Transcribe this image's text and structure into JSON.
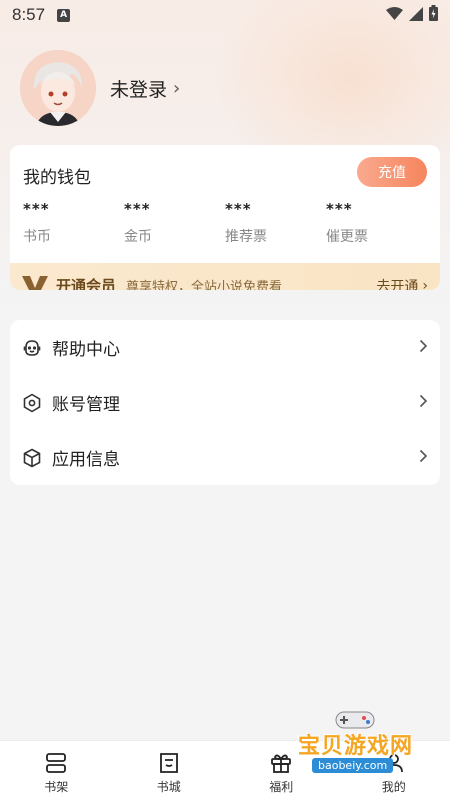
{
  "status_bar": {
    "time": "8:57",
    "indicator": "A"
  },
  "profile": {
    "login_text": "未登录",
    "chevron": "›"
  },
  "wallet": {
    "title": "我的钱包",
    "recharge_label": "充值",
    "stats": [
      {
        "value": "***",
        "label": "书币"
      },
      {
        "value": "***",
        "label": "金币"
      },
      {
        "value": "***",
        "label": "推荐票"
      },
      {
        "value": "***",
        "label": "催更票"
      }
    ],
    "vip": {
      "title": "开通会员",
      "desc": "尊享特权，全站小说免费看",
      "action": "去开通",
      "chevron": "›"
    }
  },
  "menu": [
    {
      "label": "帮助中心",
      "icon": "help-icon"
    },
    {
      "label": "账号管理",
      "icon": "account-icon"
    },
    {
      "label": "应用信息",
      "icon": "info-icon"
    }
  ],
  "tabbar": [
    {
      "label": "书架",
      "icon": "bookshelf-icon"
    },
    {
      "label": "书城",
      "icon": "bookstore-icon"
    },
    {
      "label": "福利",
      "icon": "gift-icon"
    },
    {
      "label": "我的",
      "icon": "profile-icon"
    }
  ],
  "watermark": {
    "text": "宝贝游戏网",
    "url": "baobeiy.com"
  },
  "colors": {
    "accent": "#f6855e",
    "vip_text": "#6b4a1c",
    "vip_bg": "#fbe9cf"
  }
}
